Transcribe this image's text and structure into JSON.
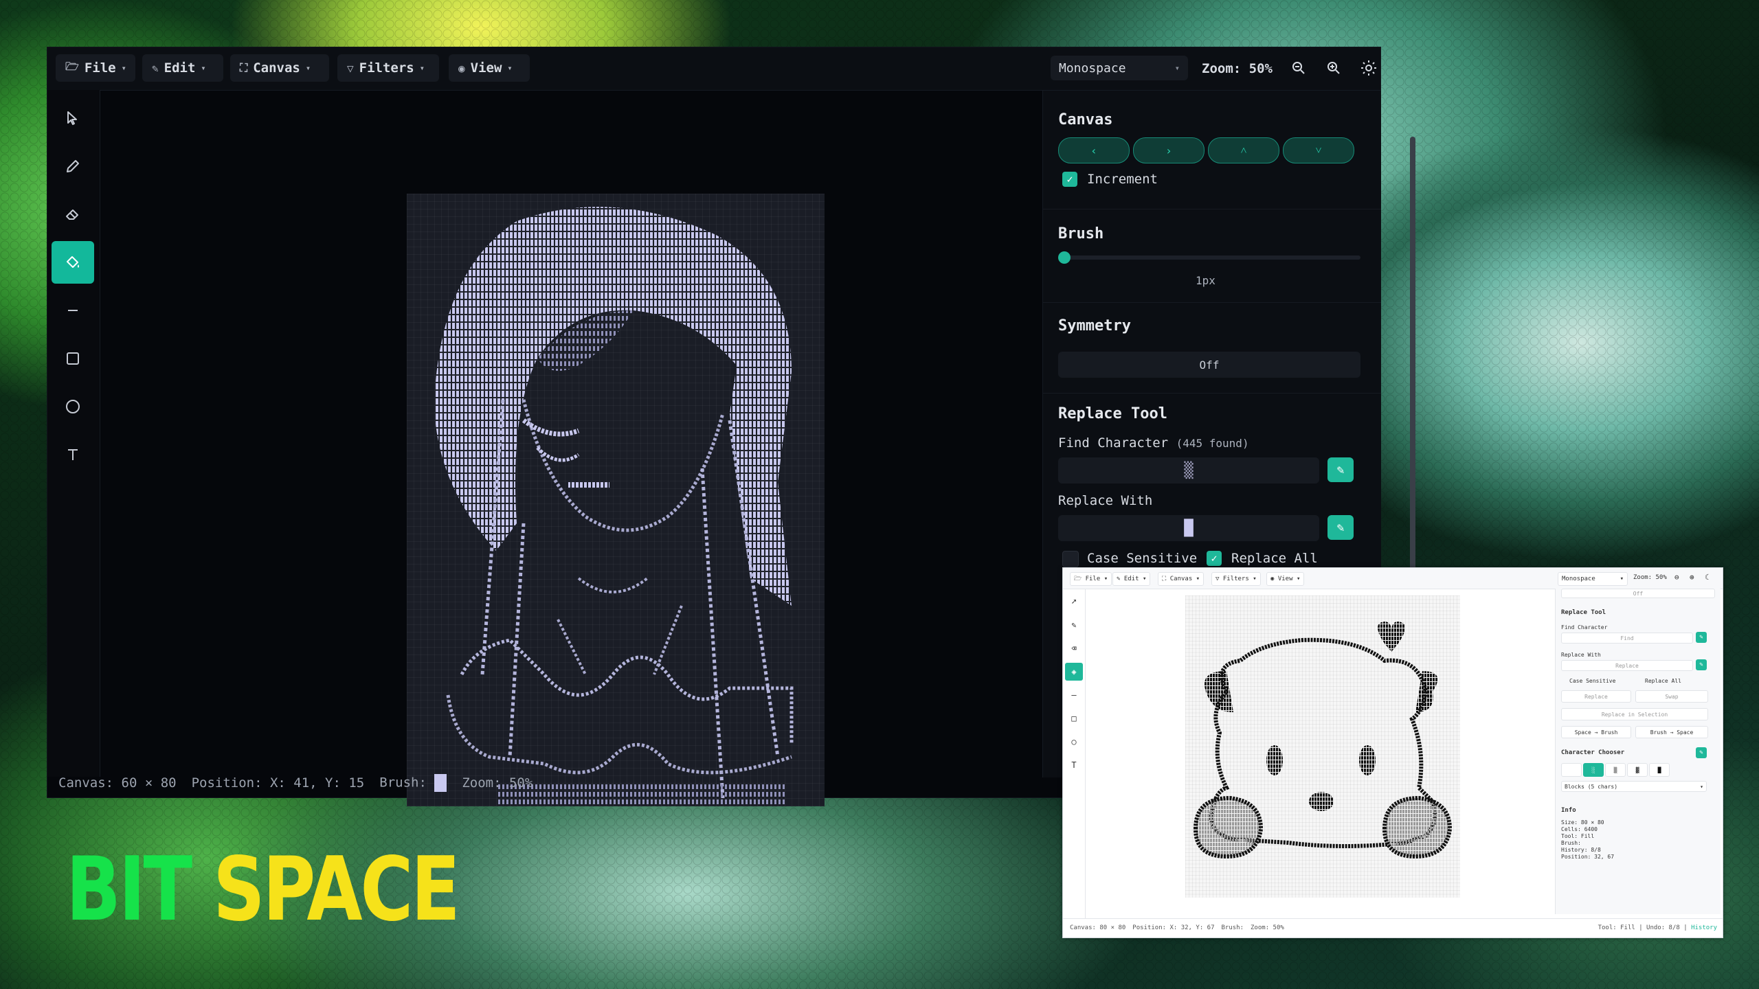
{
  "dark_app": {
    "menus": [
      {
        "label": "File",
        "icon": "folder-icon"
      },
      {
        "label": "Edit",
        "icon": "pencil-icon"
      },
      {
        "label": "Canvas",
        "icon": "expand-icon"
      },
      {
        "label": "Filters",
        "icon": "filter-icon"
      },
      {
        "label": "View",
        "icon": "eye-icon"
      }
    ],
    "font_select": "Monospace",
    "zoom_label": "Zoom: 50%",
    "tools": [
      "select-arrow-icon",
      "pencil-icon",
      "eraser-icon",
      "fill-bucket-icon",
      "line-icon",
      "rectangle-icon",
      "circle-icon",
      "text-icon"
    ],
    "active_tool": "fill-bucket-icon",
    "panel": {
      "canvas_title": "Canvas",
      "nav_buttons": [
        "‹",
        "›",
        "˄",
        "˅"
      ],
      "increment_label": "Increment",
      "increment_checked": true,
      "brush_title": "Brush",
      "brush_size": "1px",
      "brush_level": 0.0,
      "symmetry_title": "Symmetry",
      "symmetry_value": "Off",
      "replace_title": "Replace Tool",
      "find_label": "Find Character",
      "find_count": "(445 found)",
      "find_value": "▒",
      "replace_label": "Replace With",
      "replace_value": "█",
      "case_sensitive_label": "Case Sensitive",
      "case_sensitive_checked": false,
      "replace_all_label": "Replace All",
      "replace_all_checked": true
    },
    "status": {
      "canvas": "Canvas: 60 × 80",
      "position": "Position: X: 41, Y: 15",
      "brush": "Brush:",
      "zoom": "Zoom: 50%"
    },
    "accent": "#1fb89a"
  },
  "light_app": {
    "menus": [
      "File",
      "Edit",
      "Canvas",
      "Filters",
      "View"
    ],
    "font_select": "Monospace",
    "zoom_label": "Zoom: 50%",
    "panel": {
      "symmetry_value": "Off",
      "replace_title": "Replace Tool",
      "find_label": "Find Character",
      "find_placeholder": "Find",
      "replace_label": "Replace With",
      "replace_placeholder": "Replace",
      "case_sensitive": "Case Sensitive",
      "replace_all": "Replace All",
      "replace_btn": "Replace",
      "swap_btn": "Swap",
      "replace_in_selection": "Replace in Selection",
      "space_to_brush": "Space → Brush",
      "brush_to_space": "Brush → Space",
      "chooser_title": "Character Chooser",
      "chooser_chars": [
        "░",
        "▒",
        "▓",
        "█"
      ],
      "chooser_set": "Blocks (5 chars)",
      "info_title": "Info",
      "info_lines": [
        "Size: 80 × 80",
        "Cells: 6400",
        "Tool: Fill",
        "Brush:",
        "History: 8/8",
        "Position: 32, 67"
      ]
    },
    "status": {
      "canvas": "Canvas: 80 × 80",
      "position": "Position: X: 32, Y: 67",
      "brush": "Brush:",
      "zoom": "Zoom: 50%",
      "right": "Tool: Fill | Undo: 8/8 |",
      "history": "History"
    }
  },
  "logo": {
    "part1": "BIT",
    "part2": "SPACE"
  }
}
